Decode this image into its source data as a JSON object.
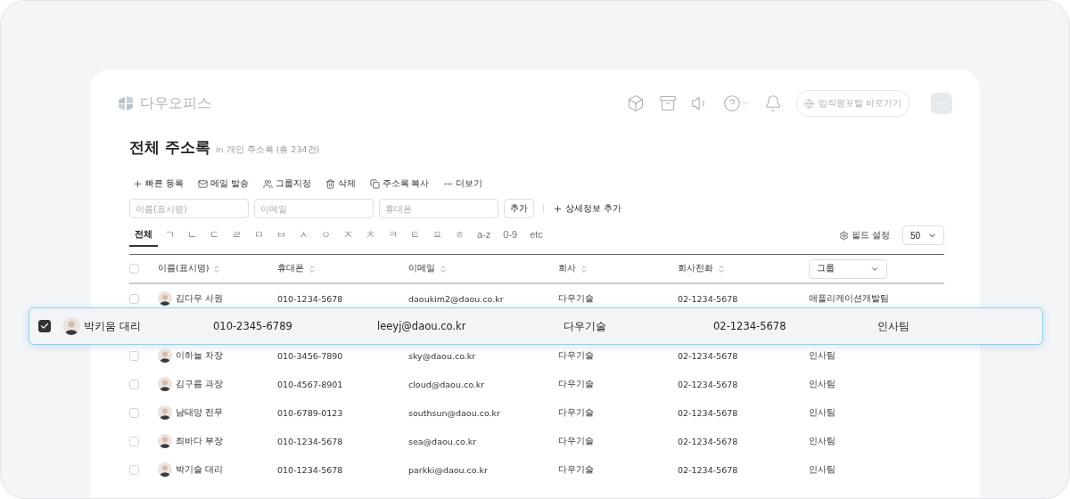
{
  "logo": {
    "text": "다우오피스"
  },
  "nav": {
    "portal_link": "임직원포털 바로가기"
  },
  "page": {
    "title": "전체 주소록",
    "subtitle": "in 개인 주소록 (총 234건)"
  },
  "actions": [
    {
      "label": "빠른 등록",
      "kind": "plus"
    },
    {
      "label": "메일 발송",
      "kind": "mail"
    },
    {
      "label": "그룹지정",
      "kind": "users"
    },
    {
      "label": "삭제",
      "kind": "trash"
    },
    {
      "label": "주소록 복사",
      "kind": "copy"
    },
    {
      "label": "더보기",
      "kind": "more"
    }
  ],
  "filters": [
    {
      "placeholder": "이름(표시명)"
    },
    {
      "placeholder": "이메일"
    },
    {
      "placeholder": "휴대폰"
    }
  ],
  "add_button": "추가",
  "detail_add": "상세정보 추가",
  "index_tabs": [
    {
      "label": "전체",
      "selected": true
    },
    {
      "label": "ㄱ",
      "selected": false
    },
    {
      "label": "ㄴ",
      "selected": false
    },
    {
      "label": "ㄷ",
      "selected": false
    },
    {
      "label": "ㄹ",
      "selected": false
    },
    {
      "label": "ㅁ",
      "selected": false
    },
    {
      "label": "ㅂ",
      "selected": false
    },
    {
      "label": "ㅅ",
      "selected": false
    },
    {
      "label": "ㅇ",
      "selected": false
    },
    {
      "label": "ㅈ",
      "selected": false
    },
    {
      "label": "ㅊ",
      "selected": false
    },
    {
      "label": "ㅋ",
      "selected": false
    },
    {
      "label": "ㅌ",
      "selected": false
    },
    {
      "label": "ㅍ",
      "selected": false
    },
    {
      "label": "ㅎ",
      "selected": false
    },
    {
      "label": "a-z",
      "selected": false
    },
    {
      "label": "0-9",
      "selected": false
    },
    {
      "label": "etc",
      "selected": false
    }
  ],
  "field_settings": "필드 설정",
  "page_size": "50",
  "table": {
    "all_checked": false,
    "columns": [
      {
        "label": "이름(표시명)",
        "kind": "sort"
      },
      {
        "label": "휴대폰",
        "kind": "sort"
      },
      {
        "label": "이메일",
        "kind": "sort"
      },
      {
        "label": "회사",
        "kind": "sort"
      },
      {
        "label": "회사전화",
        "kind": "sort"
      },
      {
        "label": "그룹",
        "kind": "dropdown"
      }
    ],
    "rows": [
      {
        "name": "김다우 사원",
        "mobile": "010-1234-5678",
        "email": "daoukim2@daou.co.kr",
        "company": "다우기술",
        "company_phone": "02-1234-5678",
        "group": "애플리케이션개발팀",
        "checked": false
      },
      {
        "name": "박키움 대리",
        "mobile": "010-2345-6789",
        "email": "leeyj@daou.co.kr",
        "company": "다우기술",
        "company_phone": "02-1234-5678",
        "group": "인사팀",
        "checked": true
      },
      {
        "name": "이하늘 차장",
        "mobile": "010-3456-7890",
        "email": "sky@daou.co.kr",
        "company": "다우기술",
        "company_phone": "02-1234-5678",
        "group": "인사팀",
        "checked": false
      },
      {
        "name": "김구름 과장",
        "mobile": "010-4567-8901",
        "email": "cloud@daou.co.kr",
        "company": "다우기술",
        "company_phone": "02-1234-5678",
        "group": "인사팀",
        "checked": false
      },
      {
        "name": "남태양 전무",
        "mobile": "010-6789-0123",
        "email": "southsun@daou.co.kr",
        "company": "다우기술",
        "company_phone": "02-1234-5678",
        "group": "인사팀",
        "checked": false
      },
      {
        "name": "최바다 부장",
        "mobile": "010-1234-5678",
        "email": "sea@daou.co.kr",
        "company": "다우기술",
        "company_phone": "02-1234-5678",
        "group": "인사팀",
        "checked": false
      },
      {
        "name": "박기술 대리",
        "mobile": "010-1234-5678",
        "email": "parkki@daou.co.kr",
        "company": "다우기술",
        "company_phone": "02-1234-5678",
        "group": "인사팀",
        "checked": false
      }
    ]
  }
}
